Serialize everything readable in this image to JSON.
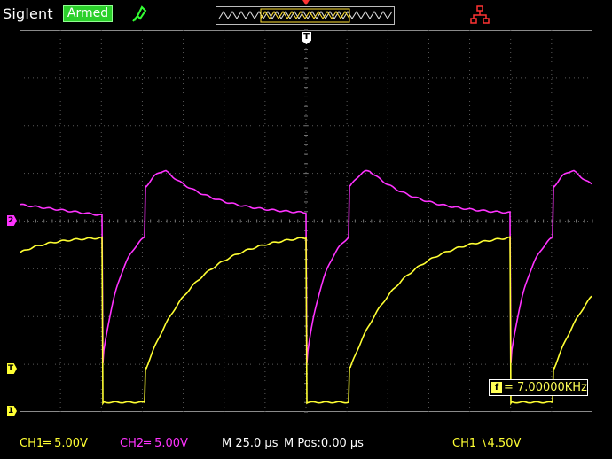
{
  "header": {
    "brand": "Siglent",
    "status": "Armed"
  },
  "markers": {
    "ch1": "1",
    "ch2": "2",
    "trigger_level": "T",
    "trigger_pos": "T"
  },
  "measure": {
    "freq_icon": "f",
    "freq_text": "= 7.00000KHz"
  },
  "footer": {
    "ch1": "CH1═ 5.00V",
    "ch2": "CH2═ 5.00V",
    "timebase": "M 25.0 µs",
    "mpos": "M Pos:0.00 µs",
    "trigger": "CH1 ∖4.50V"
  },
  "colors": {
    "ch1": "#ffff33",
    "ch2": "#ff33ff",
    "grid": "#5a5a5a",
    "status_bg": "#2bd02b"
  },
  "icons": {
    "probe": "probe-icon",
    "network": "network-icon"
  }
}
